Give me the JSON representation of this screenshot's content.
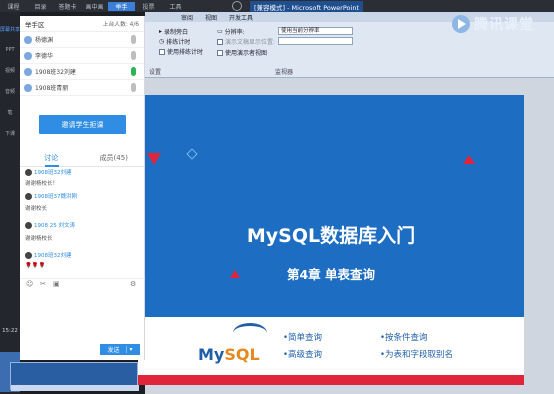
{
  "top_menu": [
    "课程",
    "目录",
    "答题卡",
    "画中画",
    "举手",
    "投票",
    "工具"
  ],
  "window_title": "[兼容模式] - Microsoft PowerPoint",
  "watermark": "腾讯课堂",
  "ribbon": {
    "tabs": [
      "审阅",
      "视图",
      "开发工具"
    ],
    "record": "录制旁白",
    "rehearse": "排练计时",
    "use_timing": "使用排练计时",
    "resolution_label": "分辨率:",
    "resolution_value": "使用当前分辨率",
    "show_on_label": "演示文稿显示位置:",
    "presenter_view": "使用演示者视图",
    "group_setup": "设置",
    "group_monitor": "监视器"
  },
  "panel": {
    "title": "举手区",
    "online": "上台人数: 4/6",
    "hands_up": [
      {
        "name": "杨德渊",
        "mic": "off"
      },
      {
        "name": "李德华",
        "mic": "off"
      },
      {
        "name": "1908班32刘建",
        "mic": "on"
      },
      {
        "name": "1908班青丽",
        "mic": "off"
      }
    ],
    "invite_button": "邀请学生拒课",
    "tab_discuss": "讨论",
    "tab_members": "成员(45)",
    "messages": [
      {
        "name": "1908班32刘建",
        "text": ""
      },
      {
        "name": "",
        "text": "谢谢杨校长！"
      },
      {
        "name": "1908班37魏洪刚",
        "text": ""
      },
      {
        "name": "",
        "text": "谢谢校长"
      },
      {
        "name": "1908 25 刘文涛",
        "text": ""
      },
      {
        "name": "",
        "text": "谢谢杨校长"
      },
      {
        "name": "1908班32刘建",
        "text": ""
      }
    ],
    "emoji_row": "🌹🌹🌹",
    "send_button": "发送"
  },
  "rail": {
    "items": [
      "屏幕共享",
      "PPT",
      "视频",
      "音频",
      "笔",
      "下课"
    ],
    "clock": "15:22"
  },
  "slide": {
    "title": "MySQL数据库入门",
    "subtitle": "第4章  单表查询",
    "logo_main": "My",
    "logo_sql": "SQL",
    "bullets": [
      "•简单查询",
      "•高级查询",
      "•按条件查询",
      "•为表和字段取别名"
    ]
  }
}
